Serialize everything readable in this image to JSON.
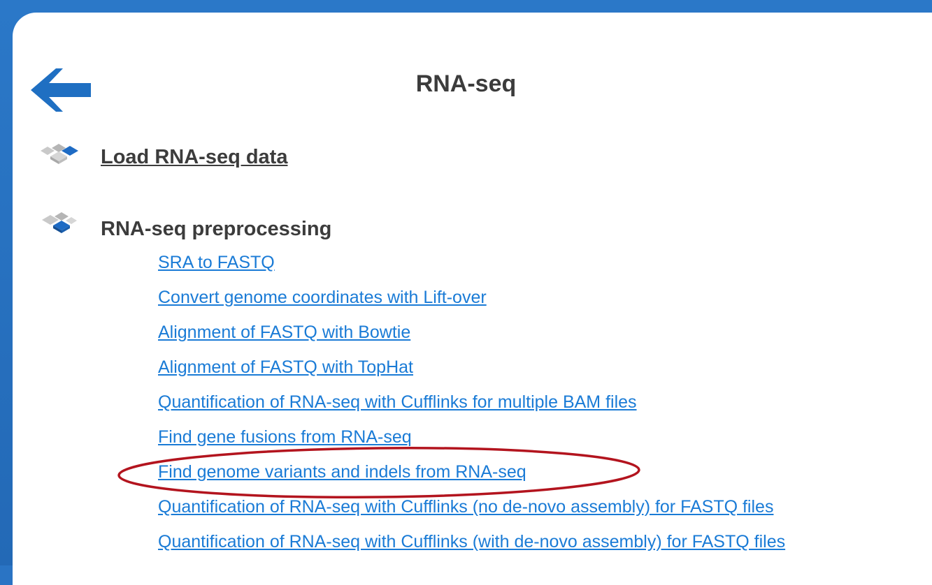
{
  "page": {
    "title": "RNA-seq"
  },
  "nav": {
    "back_icon": "left-arrow-icon"
  },
  "sections": [
    {
      "label": "Load RNA-seq data",
      "icon": "stacked-diamonds-icon",
      "is_link": true
    },
    {
      "label": "RNA-seq preprocessing",
      "icon": "stacked-diamonds-icon",
      "is_link": false,
      "links": [
        "SRA to FASTQ",
        "Convert genome coordinates with Lift-over",
        "Alignment of FASTQ with Bowtie",
        "Alignment of FASTQ with TopHat",
        "Quantification of RNA-seq with Cufflinks for multiple BAM files",
        "Find gene fusions from RNA-seq",
        "Find genome variants and indels from RNA-seq",
        "Quantification of RNA-seq with Cufflinks (no de-novo assembly) for FASTQ files",
        "Quantification of RNA-seq with Cufflinks (with de-novo assembly) for FASTQ files"
      ]
    }
  ],
  "annotation": {
    "highlighted_item": "Find genome variants and indels from RNA-seq",
    "color": "#b3141e"
  },
  "colors": {
    "frame": "#2a74c4",
    "link": "#1a7bd6",
    "heading": "#3c3c3c",
    "arrow": "#1f6fc2"
  }
}
